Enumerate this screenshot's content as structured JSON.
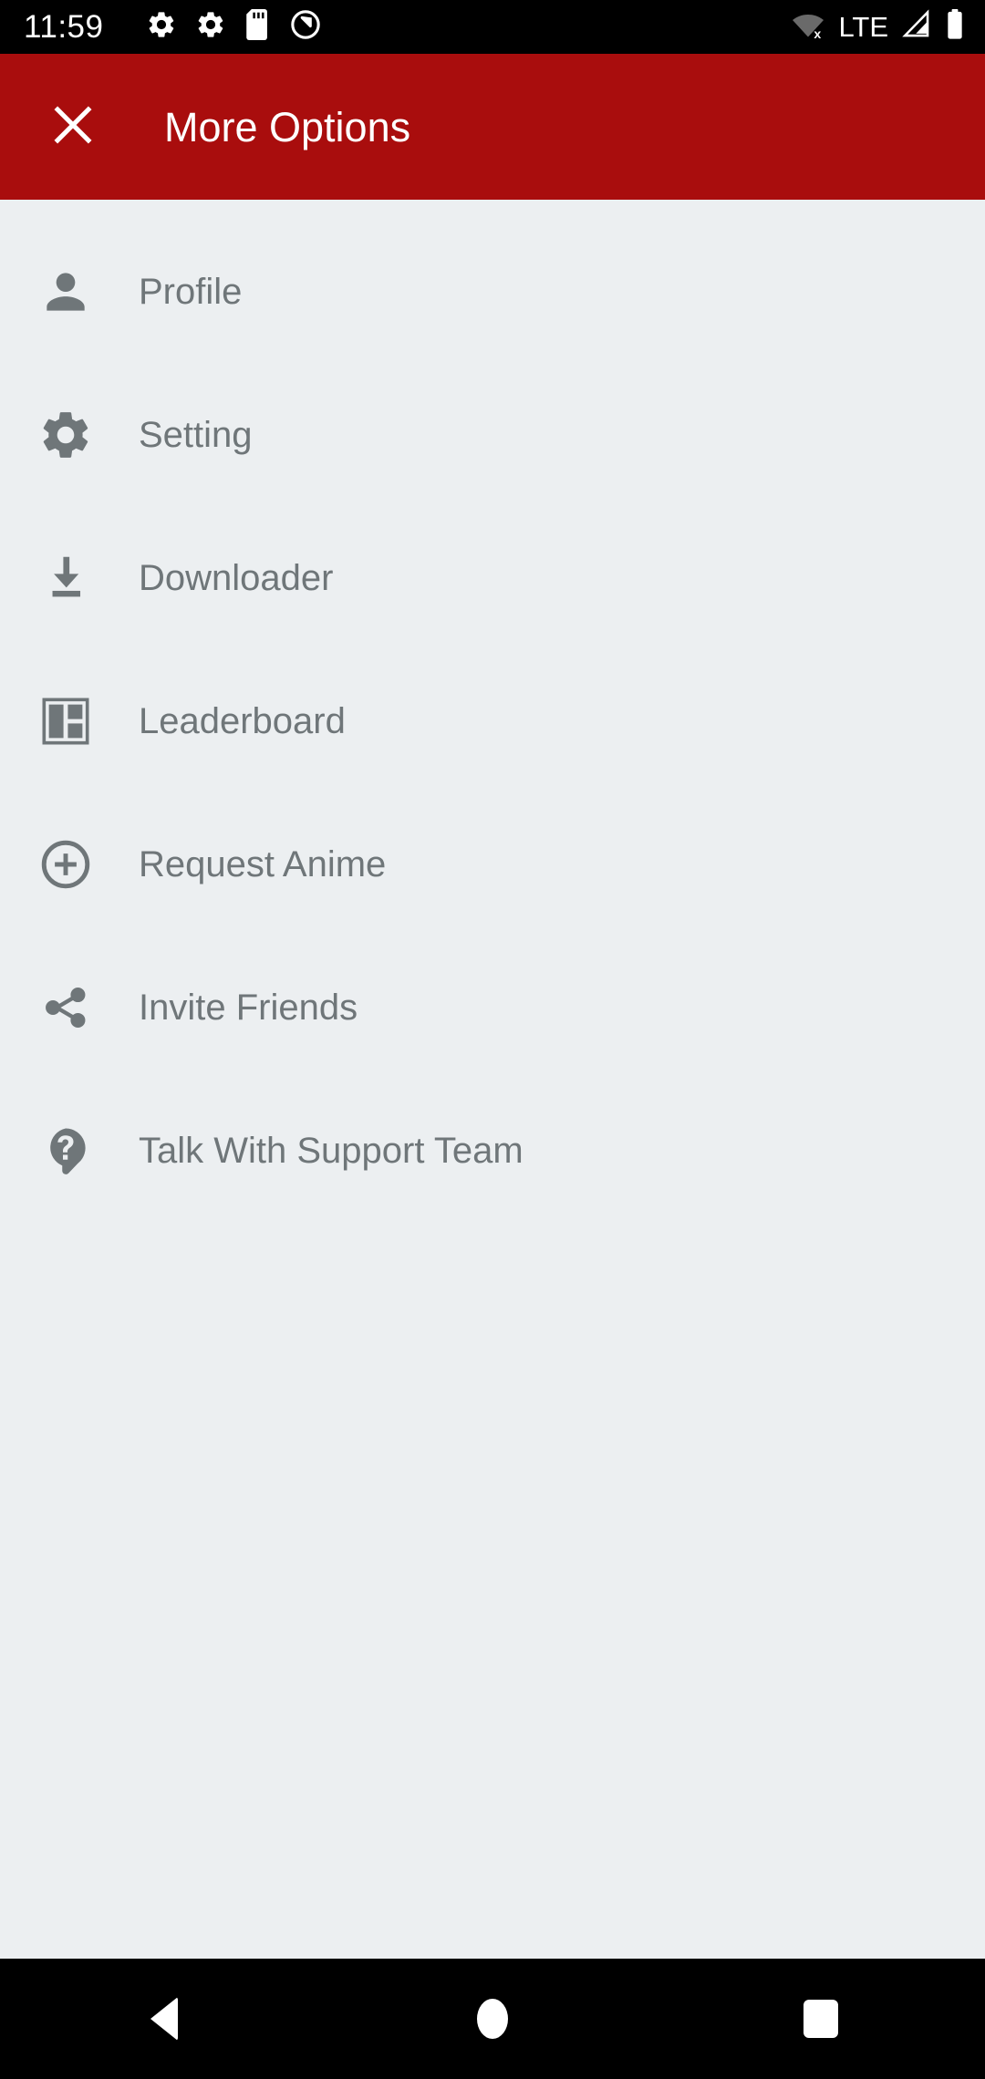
{
  "status_bar": {
    "time": "11:59",
    "left_icons": [
      "gear-icon",
      "gear-icon",
      "sd-card-icon",
      "do-not-disturb-icon"
    ],
    "network_label": "LTE",
    "right_icons": [
      "wifi-off-icon",
      "signal-icon",
      "battery-icon"
    ]
  },
  "app_bar": {
    "close_icon": "close-icon",
    "title": "More Options",
    "background_color": "#a90d0d",
    "title_color": "#ffffff"
  },
  "menu": {
    "background_color": "#eceff1",
    "label_color": "#6f7679",
    "items": [
      {
        "label": "Profile",
        "icon": "person-icon"
      },
      {
        "label": "Setting",
        "icon": "gear-icon"
      },
      {
        "label": "Downloader",
        "icon": "download-icon"
      },
      {
        "label": "Leaderboard",
        "icon": "dashboard-icon"
      },
      {
        "label": "Request Anime",
        "icon": "plus-circle-icon"
      },
      {
        "label": "Invite Friends",
        "icon": "share-icon"
      },
      {
        "label": "Talk With Support Team",
        "icon": "help-bubble-icon"
      }
    ]
  },
  "nav_bar": {
    "background_color": "#000000",
    "buttons": [
      {
        "name": "back-button",
        "icon": "triangle-left-icon"
      },
      {
        "name": "home-button",
        "icon": "circle-icon"
      },
      {
        "name": "recents-button",
        "icon": "square-icon"
      }
    ]
  }
}
